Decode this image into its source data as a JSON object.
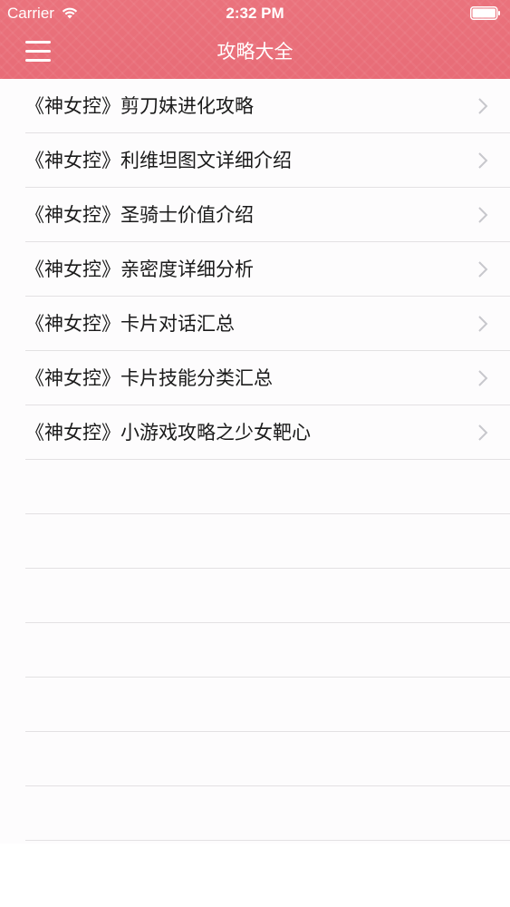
{
  "status_bar": {
    "carrier": "Carrier",
    "time": "2:32 PM",
    "wifi_icon": "wifi-icon",
    "battery_icon": "battery-icon"
  },
  "nav": {
    "title": "攻略大全",
    "menu_icon": "hamburger-menu-icon"
  },
  "colors": {
    "header": "#e9707a",
    "text": "#1a1a1a",
    "separator": "#e3e1e3",
    "chevron": "#c7c7cc"
  },
  "list": {
    "items": [
      {
        "label": "《神女控》剪刀妹进化攻略"
      },
      {
        "label": "《神女控》利维坦图文详细介绍"
      },
      {
        "label": "《神女控》圣骑士价值介绍"
      },
      {
        "label": "《神女控》亲密度详细分析"
      },
      {
        "label": "《神女控》卡片对话汇总"
      },
      {
        "label": "《神女控》卡片技能分类汇总"
      },
      {
        "label": "《神女控》小游戏攻略之少女靶心"
      }
    ],
    "chevron_icon": "chevron-right-icon"
  }
}
